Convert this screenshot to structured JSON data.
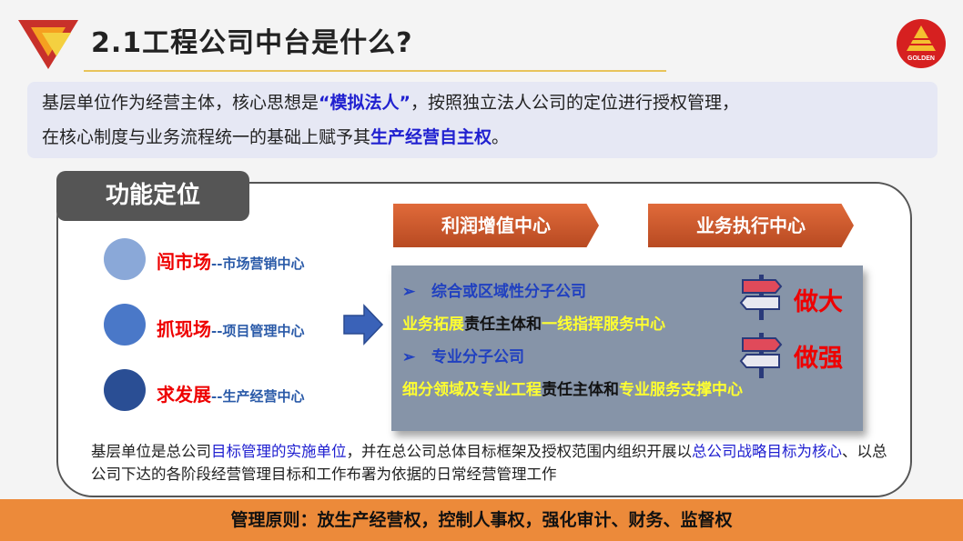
{
  "title": "2.1工程公司中台是什么?",
  "brand_logo_text": "GOLDEN",
  "intro": {
    "line1_pre": "基层单位作为经营主体，核心思想是",
    "line1_hl": "“模拟法人”",
    "line1_post": "，按照独立法人公司的定位进行授权管理，",
    "line2_pre": "在核心制度与业务流程统一的基础上赋予其",
    "line2_hl": "生产经营自主权",
    "line2_post": "。"
  },
  "function_tab": "功能定位",
  "roles": [
    {
      "main": "闯市场",
      "sub": "--市场营销中心",
      "color": "#8aa8d8"
    },
    {
      "main": "抓现场",
      "sub": "--项目管理中心",
      "color": "#4a78c8"
    },
    {
      "main": "求发展",
      "sub": "--生产经营中心",
      "color": "#2a4e94"
    }
  ],
  "banners": {
    "left": "利润增值中心",
    "right": "业务执行中心"
  },
  "box": {
    "bullet1": "综合或区域性分子公司",
    "line2_a": "业务拓展",
    "line2_b": "责任主体和",
    "line2_c": "一线指挥服务中心",
    "bullet2": "专业分子公司",
    "line4_a": "细分领域及专业工程",
    "line4_b": "责任主体和",
    "line4_c": "专业服务支撑中心"
  },
  "do_big": "做大",
  "do_strong": "做强",
  "bottom": {
    "p1": "基层单位是总公司",
    "b1": "目标管理的实施单位",
    "p2": "，并在总公司总体目标框架及授权范围内组织开展以",
    "b2": "总公司战略目标为核心",
    "p3": "、以总公司下达的各阶段经营管理目标和工作布署为依据的日常经营管理工作"
  },
  "footer": "管理原则：放生产经营权，控制人事权，强化审计、财务、监督权",
  "colors": {
    "accent_orange": "#ec8a3a",
    "highlight_blue": "#2020d0",
    "red": "#e00000",
    "yellow": "#ffff30"
  }
}
